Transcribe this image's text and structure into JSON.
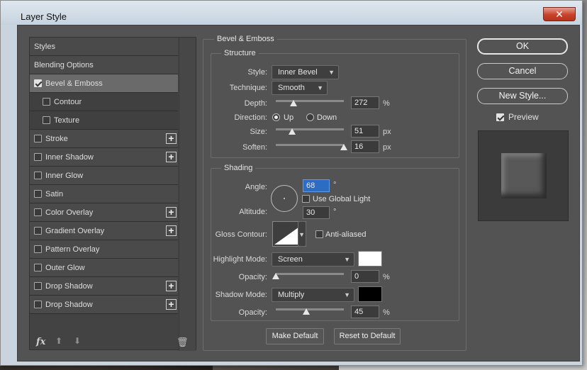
{
  "window": {
    "title": "Layer Style",
    "close_glyph": "✕"
  },
  "styles_panel": {
    "items": [
      {
        "label": "Styles"
      },
      {
        "label": "Blending Options"
      },
      {
        "label": "Bevel & Emboss",
        "checked": true,
        "selected": true
      },
      {
        "label": "Contour",
        "checked": false
      },
      {
        "label": "Texture",
        "checked": false
      },
      {
        "label": "Stroke",
        "checked": false
      },
      {
        "label": "Inner Shadow",
        "checked": false
      },
      {
        "label": "Inner Glow",
        "checked": false
      },
      {
        "label": "Satin",
        "checked": false
      },
      {
        "label": "Color Overlay",
        "checked": false
      },
      {
        "label": "Gradient Overlay",
        "checked": false
      },
      {
        "label": "Pattern Overlay",
        "checked": false
      },
      {
        "label": "Outer Glow",
        "checked": false
      },
      {
        "label": "Drop Shadow",
        "checked": false
      },
      {
        "label": "Drop Shadow",
        "checked": false
      }
    ],
    "plus_glyph": "+",
    "footer": {
      "fx": "fx",
      "up": "⬆",
      "down": "⬇",
      "trash": "🗑"
    }
  },
  "bevel": {
    "group_title": "Bevel & Emboss",
    "structure": {
      "title": "Structure",
      "style_label": "Style:",
      "style_value": "Inner Bevel",
      "technique_label": "Technique:",
      "technique_value": "Smooth",
      "depth_label": "Depth:",
      "depth_value": "272",
      "depth_unit": "%",
      "depth_level": 0.27,
      "direction_label": "Direction:",
      "direction_up": "Up",
      "direction_down": "Down",
      "size_label": "Size:",
      "size_value": "51",
      "size_unit": "px",
      "size_level": 0.24,
      "soften_label": "Soften:",
      "soften_value": "16",
      "soften_unit": "px",
      "soften_level": 0.98
    },
    "shading": {
      "title": "Shading",
      "angle_label": "Angle:",
      "angle_value": "68",
      "degree": "°",
      "global_light": "Use Global Light",
      "altitude_label": "Altitude:",
      "altitude_value": "30",
      "gloss_label": "Gloss Contour:",
      "anti_aliased": "Anti-aliased",
      "highlight_label": "Highlight Mode:",
      "highlight_value": "Screen",
      "highlight_color": "#ffffff",
      "opacity_label": "Opacity:",
      "highlight_opacity": "0",
      "highlight_level": 0.0,
      "shadow_label": "Shadow Mode:",
      "shadow_value": "Multiply",
      "shadow_color": "#000000",
      "shadow_opacity": "45",
      "shadow_level": 0.45,
      "percent": "%"
    },
    "make_default": "Make Default",
    "reset_default": "Reset to Default"
  },
  "right": {
    "ok": "OK",
    "cancel": "Cancel",
    "new_style": "New Style...",
    "preview": "Preview"
  },
  "colors": {
    "dialog_bg": "#535353",
    "accent_select": "#2b6cc4"
  }
}
